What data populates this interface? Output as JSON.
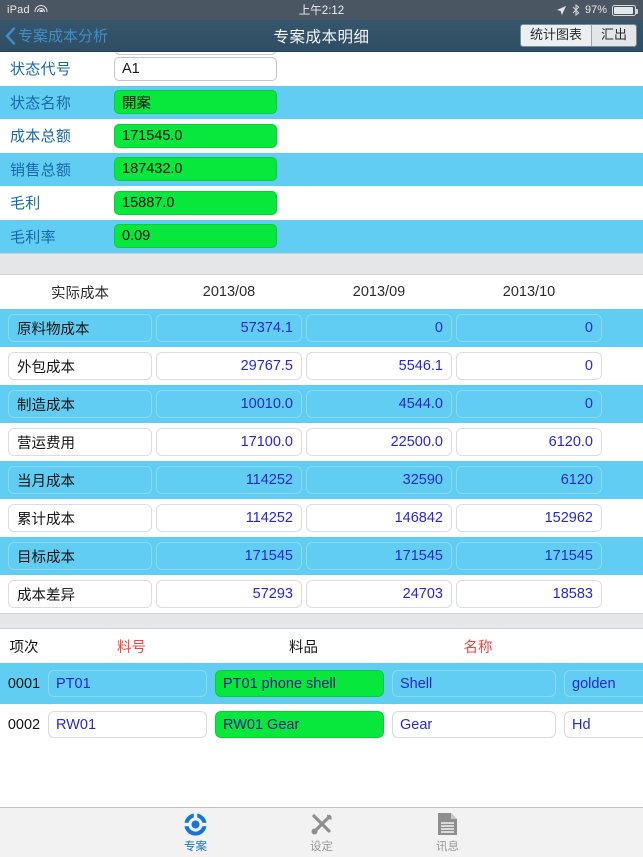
{
  "statusbar": {
    "device": "iPad",
    "wifi_icon": "wifi-icon",
    "time": "上午2:12",
    "location_icon": "location-arrow-icon",
    "bluetooth_icon": "bluetooth-icon",
    "battery_percent": "97%",
    "battery_icon": "battery-icon",
    "battery_level": 97
  },
  "navbar": {
    "back_icon": "chevron-left-icon",
    "back_label": "专案成本分析",
    "title": "专案成本明细",
    "segments": [
      {
        "label": "统计图表"
      },
      {
        "label": "汇出"
      }
    ]
  },
  "header_form": {
    "rows": [
      {
        "label": "状态代号",
        "value": "A1",
        "style": "plain"
      },
      {
        "label": "状态名称",
        "value": "開案",
        "style": "green"
      },
      {
        "label": "成本总额",
        "value": "171545.0",
        "style": "green"
      },
      {
        "label": "销售总额",
        "value": "187432.0",
        "style": "green"
      },
      {
        "label": "毛利",
        "value": "15887.0",
        "style": "green"
      },
      {
        "label": "毛利率",
        "value": "0.09",
        "style": "green"
      }
    ]
  },
  "cost_table": {
    "headers": [
      "实际成本",
      "2013/08",
      "2013/09",
      "2013/10"
    ],
    "rows": [
      {
        "label": "原料物成本",
        "values": [
          "57374.1",
          "0",
          "0"
        ]
      },
      {
        "label": "外包成本",
        "values": [
          "29767.5",
          "5546.1",
          "0"
        ]
      },
      {
        "label": "制造成本",
        "values": [
          "10010.0",
          "4544.0",
          "0"
        ]
      },
      {
        "label": "营运费用",
        "values": [
          "17100.0",
          "22500.0",
          "6120.0"
        ]
      },
      {
        "label": "当月成本",
        "values": [
          "114252",
          "32590",
          "6120"
        ]
      },
      {
        "label": "累计成本",
        "values": [
          "114252",
          "146842",
          "152962"
        ]
      },
      {
        "label": "目标成本",
        "values": [
          "171545",
          "171545",
          "171545"
        ]
      },
      {
        "label": "成本差异",
        "values": [
          "57293",
          "24703",
          "18583"
        ]
      }
    ]
  },
  "item_list": {
    "headers": [
      {
        "label": "项次",
        "color": "#161616"
      },
      {
        "label": "料号",
        "color": "#f4463f"
      },
      {
        "label": "料品",
        "color": "#161616"
      },
      {
        "label": "名称",
        "color": "#f4463f"
      }
    ],
    "rows": [
      {
        "seq": "0001",
        "part_no": "PT01",
        "part": "PT01 phone shell",
        "name": "Shell",
        "extra": "golden"
      },
      {
        "seq": "0002",
        "part_no": "RW01",
        "part": "RW01 Gear",
        "name": "Gear",
        "extra": "Hd"
      }
    ]
  },
  "tabbar": {
    "tabs": [
      {
        "label": "专案",
        "icon": "project-ring-icon",
        "state": "active"
      },
      {
        "label": "设定",
        "icon": "tools-gear-icon",
        "state": "inactive"
      },
      {
        "label": "讯息",
        "icon": "document-lines-icon",
        "state": "inactive"
      }
    ]
  },
  "colors": {
    "navbar": "#335468",
    "row_highlight": "#61cdf2",
    "field_green": "#08e83c",
    "value_blue": "#2727d8",
    "label_blue": "#1869a8",
    "accent_red": "#f4463f",
    "tab_active": "#1676d6"
  }
}
